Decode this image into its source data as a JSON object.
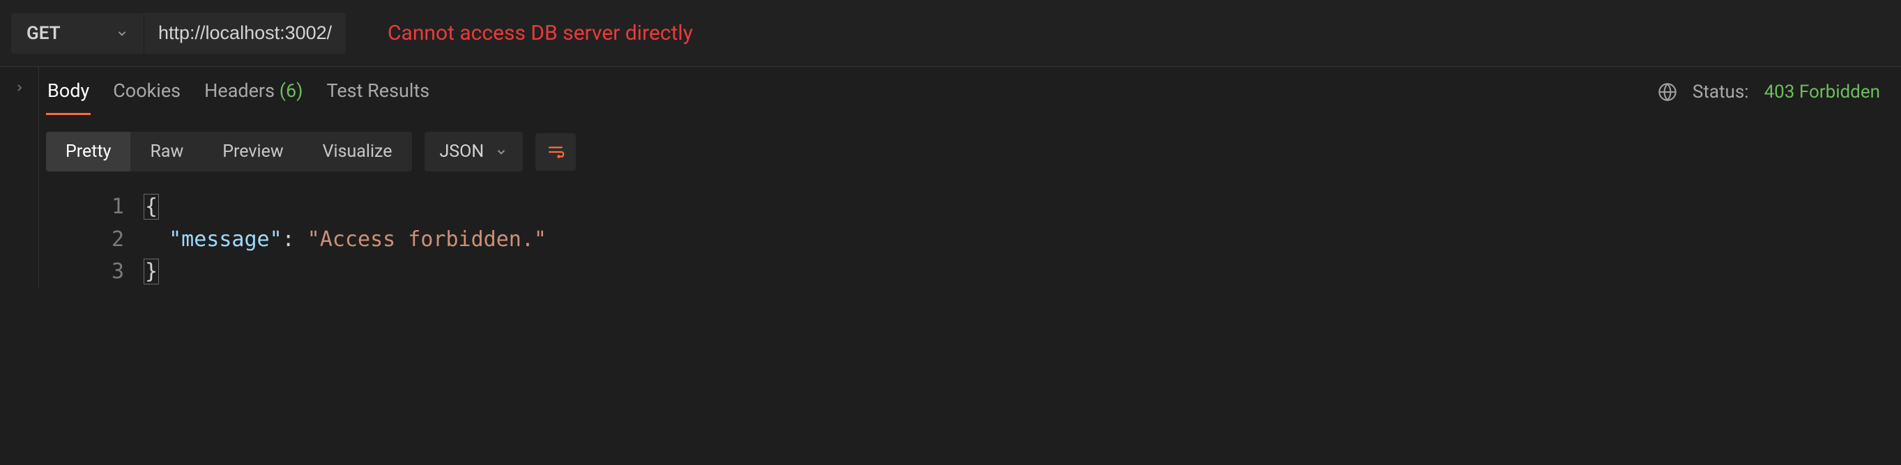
{
  "request": {
    "method": "GET",
    "url": "http://localhost:3002/",
    "annotation": "Cannot access DB server directly"
  },
  "response": {
    "tabs": {
      "body": "Body",
      "cookies": "Cookies",
      "headers_label": "Headers",
      "headers_count": "(6)",
      "test_results": "Test Results"
    },
    "status_label": "Status:",
    "status_value": "403 Forbidden",
    "view_modes": {
      "pretty": "Pretty",
      "raw": "Raw",
      "preview": "Preview",
      "visualize": "Visualize"
    },
    "format": "JSON",
    "body": {
      "lines": [
        "1",
        "2",
        "3"
      ],
      "open_brace": "{",
      "key_quoted": "\"message\"",
      "colon_space": ": ",
      "value_quoted": "\"Access forbidden.\"",
      "close_brace": "}"
    }
  }
}
